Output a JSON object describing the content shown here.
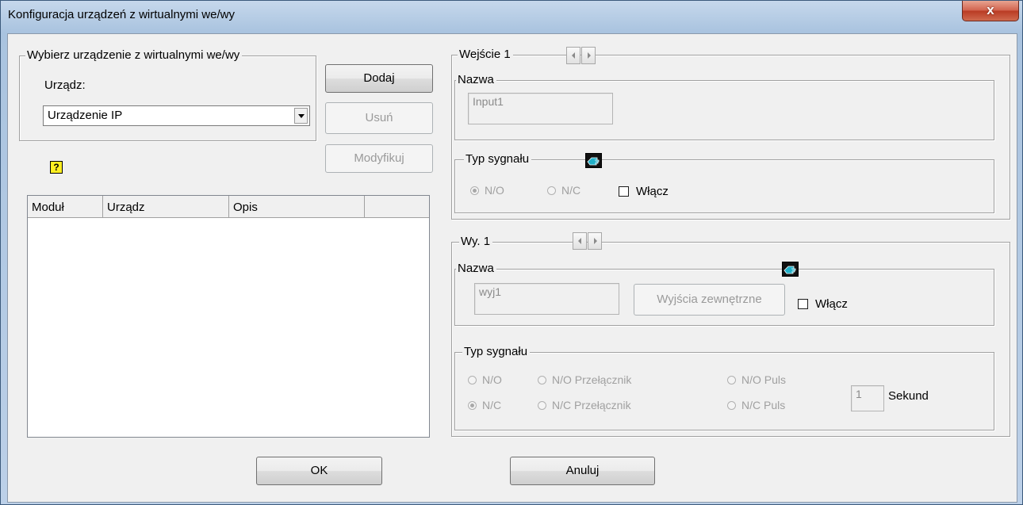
{
  "window": {
    "title": "Konfiguracja urządzeń z wirtualnymi we/wy",
    "close_glyph": "x"
  },
  "device_group": {
    "legend": "Wybierz urządzenie z wirtualnymi we/wy",
    "device_label": "Urządz:",
    "device_value": "Urządzenie IP"
  },
  "buttons": {
    "add": "Dodaj",
    "remove": "Usuń",
    "modify": "Modyfikuj",
    "ok": "OK",
    "cancel": "Anuluj"
  },
  "help_icon": "?",
  "device_list": {
    "columns": [
      "Moduł",
      "Urządz",
      "Opis",
      ""
    ]
  },
  "input_group": {
    "legend": "Wejście 1",
    "name_legend": "Nazwa",
    "name_value": "Input1",
    "signal_legend": "Typ sygnału",
    "radio_no": "N/O",
    "radio_nc": "N/C",
    "selected": "N/O",
    "enable_label": "Włącz"
  },
  "output_group": {
    "legend": "Wy. 1",
    "name_legend": "Nazwa",
    "name_value": "wyj1",
    "external_button": "Wyjścia zewnętrzne",
    "enable_label": "Włącz",
    "signal_legend": "Typ sygnału",
    "radios": [
      "N/O",
      "N/O Przełącznik",
      "N/O Puls",
      "N/C",
      "N/C Przełącznik",
      "N/C Puls"
    ],
    "selected": "N/C",
    "seconds_value": "1",
    "seconds_label": "Sekund"
  },
  "colors": {
    "accent_title": "#c6d8ec",
    "close": "#c94a33",
    "help": "#ffef21",
    "hand": "#22b0c8"
  }
}
